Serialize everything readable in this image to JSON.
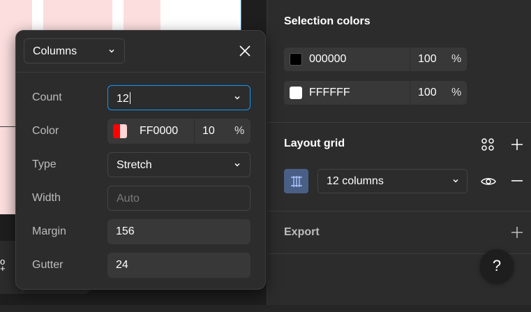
{
  "popup": {
    "grid_type": "Columns",
    "fields": {
      "count": {
        "label": "Count",
        "value": "12"
      },
      "color": {
        "label": "Color",
        "hex": "FF0000",
        "opacity": "10",
        "unit": "%"
      },
      "type": {
        "label": "Type",
        "value": "Stretch"
      },
      "width": {
        "label": "Width",
        "placeholder": "Auto"
      },
      "margin": {
        "label": "Margin",
        "value": "156"
      },
      "gutter": {
        "label": "Gutter",
        "value": "24"
      }
    }
  },
  "right_panel": {
    "selection_colors": {
      "title": "Selection colors",
      "items": [
        {
          "hex": "000000",
          "opacity": "100",
          "unit": "%",
          "swatch": "#000000"
        },
        {
          "hex": "FFFFFF",
          "opacity": "100",
          "unit": "%",
          "swatch": "#FFFFFF"
        }
      ]
    },
    "layout_grid": {
      "title": "Layout grid",
      "grid_label": "12 columns"
    },
    "export": {
      "title": "Export"
    },
    "help": "?"
  },
  "canvas": {
    "glyph": "o\n+"
  },
  "colors": {
    "accent": "#0d99ff",
    "grid_red": "#FF0000",
    "grid_icon_bg": "#4a5f85"
  }
}
